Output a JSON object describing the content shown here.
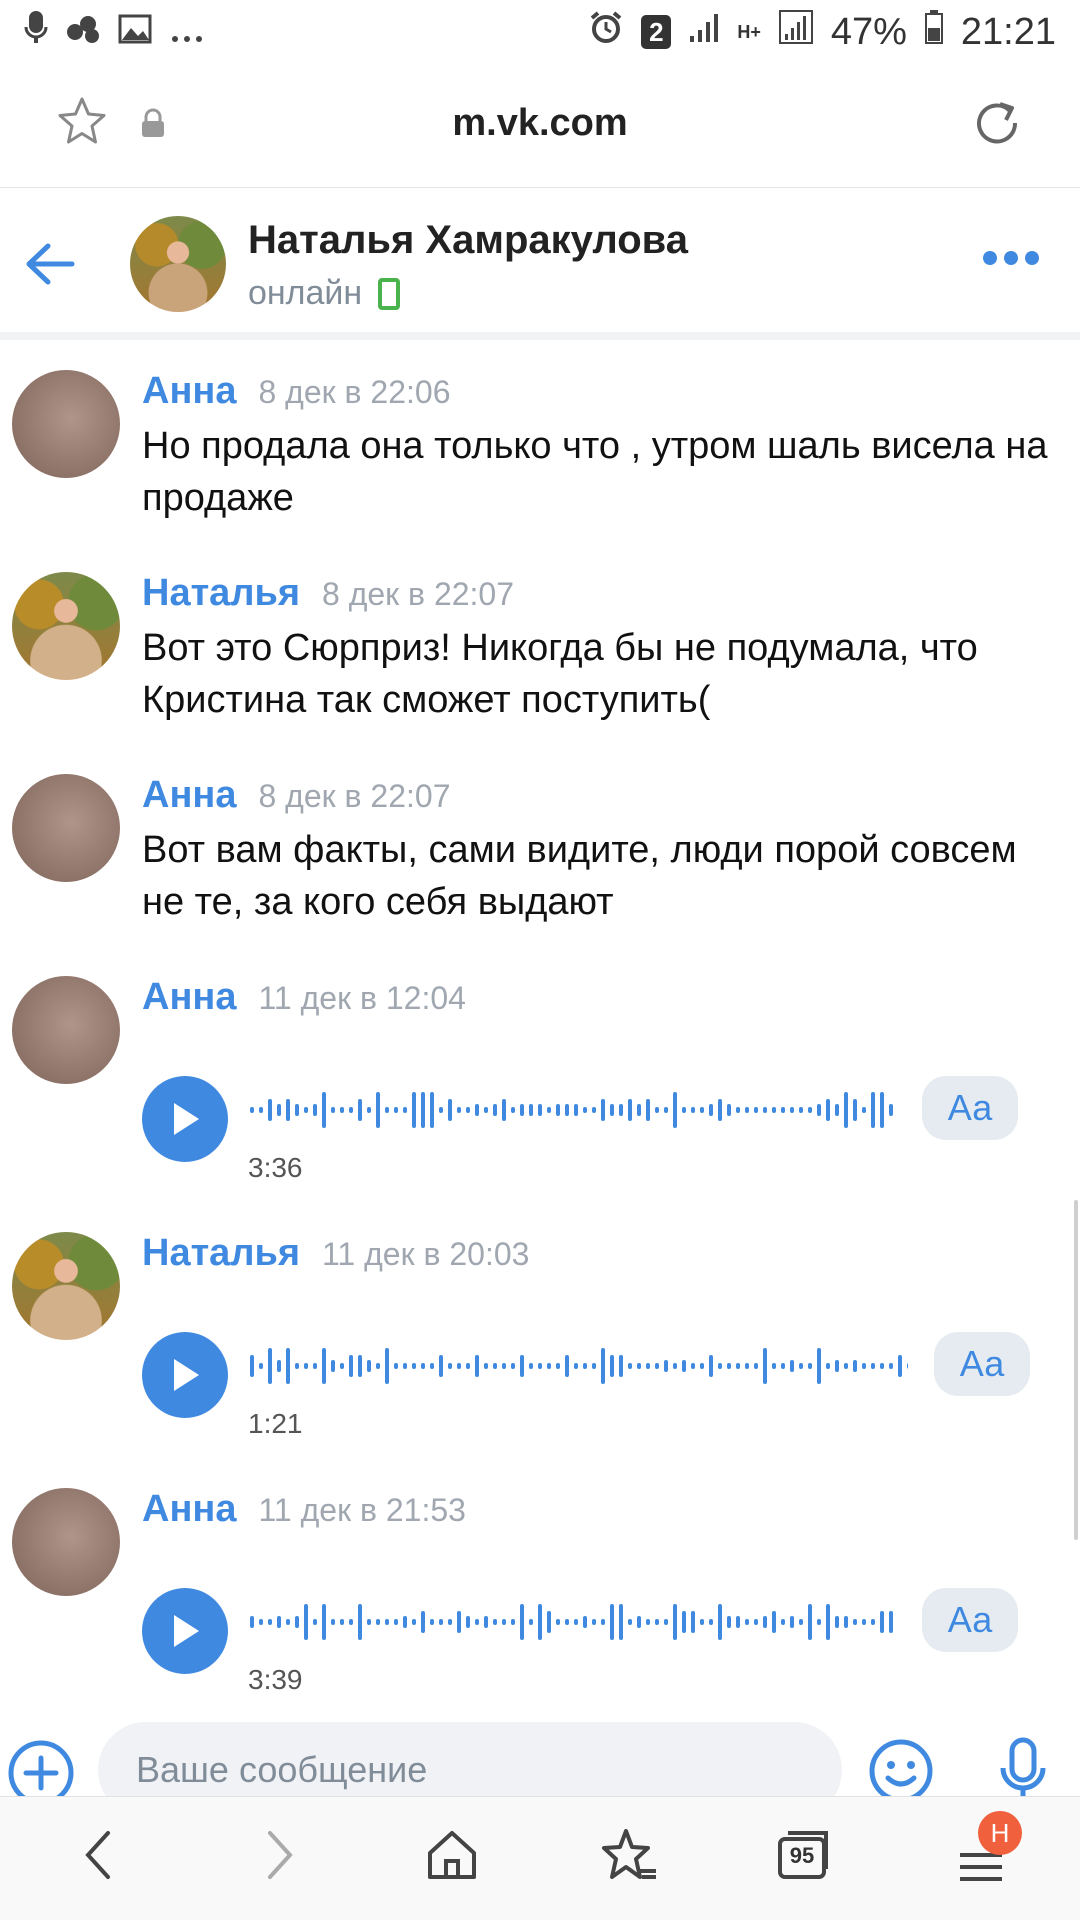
{
  "status_bar": {
    "notification_count": "2",
    "network": "H+",
    "battery": "47%",
    "time": "21:21"
  },
  "browser": {
    "url": "m.vk.com",
    "tabs_count": "95",
    "notification_badge": "H"
  },
  "chat": {
    "name": "Наталья Хамракулова",
    "status": "онлайн"
  },
  "messages": [
    {
      "author": "Анна",
      "time": "8 дек в 22:06",
      "text": "Но продала она только что , утром шаль висела на продаже"
    },
    {
      "author": "Наталья",
      "time": "8 дек в 22:07",
      "text": "Вот это Сюрприз! Никогда бы не подумала, что Кристина так сможет поступить("
    },
    {
      "author": "Анна",
      "time": "8 дек в 22:07",
      "text": "Вот вам факты, сами видите, люди порой совсем не те, за кого себя выдают"
    },
    {
      "author": "Анна",
      "time": "11 дек в 12:04",
      "duration": "3:36",
      "transcribe_label": "Аа"
    },
    {
      "author": "Наталья",
      "time": "11 дек в 20:03",
      "duration": "1:21",
      "transcribe_label": "Аа"
    },
    {
      "author": "Анна",
      "time": "11 дек в 21:53",
      "duration": "3:39",
      "transcribe_label": "Аа"
    }
  ],
  "composer": {
    "placeholder": "Ваше сообщение"
  },
  "colors": {
    "accent": "#3f8ae0",
    "secondary_text": "#818c99",
    "online": "#4bb34b",
    "badge": "#f0603c"
  }
}
